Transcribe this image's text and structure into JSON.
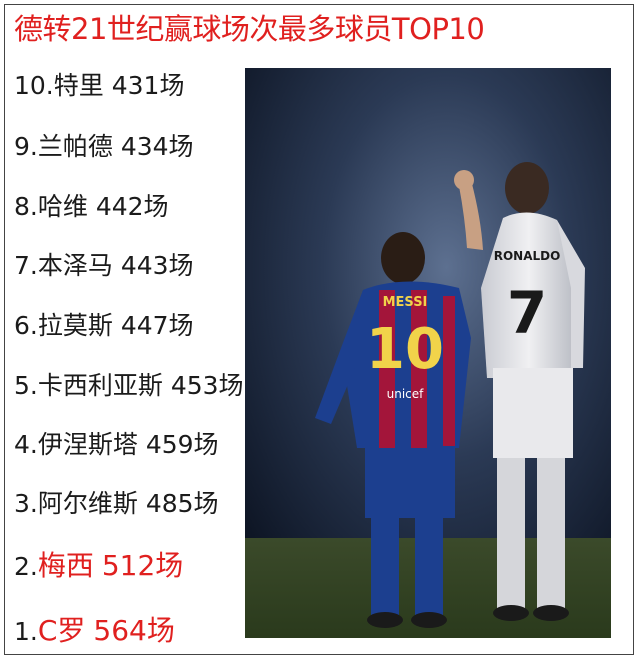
{
  "title": "德转21世纪赢球场次最多球员TOP10",
  "players": [
    {
      "rank": "10.",
      "name": "特里",
      "count": "431场",
      "highlight": false
    },
    {
      "rank": "9.",
      "name": "兰帕德",
      "count": "434场",
      "highlight": false
    },
    {
      "rank": "8.",
      "name": "哈维",
      "count": "442场",
      "highlight": false
    },
    {
      "rank": "7.",
      "name": "本泽马",
      "count": "443场",
      "highlight": false
    },
    {
      "rank": "6.",
      "name": "拉莫斯",
      "count": "447场",
      "highlight": false
    },
    {
      "rank": "5.",
      "name": "卡西利亚斯",
      "count": "453场",
      "highlight": false
    },
    {
      "rank": "4.",
      "name": "伊涅斯塔",
      "count": "459场",
      "highlight": false
    },
    {
      "rank": "3.",
      "name": "阿尔维斯",
      "count": "485场",
      "highlight": false
    },
    {
      "rank": "2.",
      "name": "梅西",
      "count": "512场",
      "highlight": true
    },
    {
      "rank": "1.",
      "name": "C罗",
      "count": "564场",
      "highlight": true
    }
  ],
  "photo": {
    "left_jersey_name": "MESSI",
    "left_jersey_number": "10",
    "left_jersey_sponsor": "unicef",
    "right_jersey_name": "RONALDO",
    "right_jersey_number": "7"
  },
  "colors": {
    "title_red": "#e0201f",
    "text": "#1b1b1b",
    "barca_blue": "#1c3f8f",
    "barca_red": "#a3153a",
    "madrid_white": "#e9e9ec"
  }
}
